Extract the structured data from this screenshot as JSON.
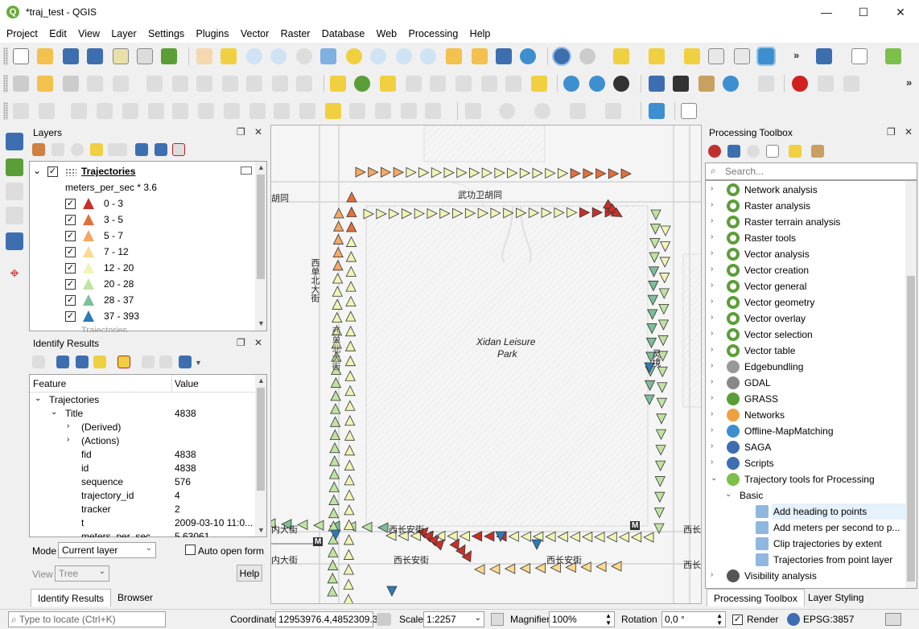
{
  "window": {
    "title": "*traj_test - QGIS",
    "minimize": "—",
    "maximize": "☐",
    "close": "✕"
  },
  "menu": [
    "Project",
    "Edit",
    "View",
    "Layer",
    "Settings",
    "Plugins",
    "Vector",
    "Raster",
    "Database",
    "Web",
    "Processing",
    "Help"
  ],
  "layers_panel": {
    "title": "Layers",
    "layer_name": "Trajectories",
    "classification_attr": "meters_per_sec * 3.6",
    "classes": [
      {
        "label": "0 - 3",
        "color": "#c8302a"
      },
      {
        "label": "3 - 5",
        "color": "#e36f3b"
      },
      {
        "label": "5 - 7",
        "color": "#f4a864"
      },
      {
        "label": "7 - 12",
        "color": "#fbd98e"
      },
      {
        "label": "12 - 20",
        "color": "#f0f5b6"
      },
      {
        "label": "20 - 28",
        "color": "#bfe3a2"
      },
      {
        "label": "28 - 37",
        "color": "#7cbf9a"
      },
      {
        "label": "37 - 393",
        "color": "#2c7bb6"
      }
    ],
    "second_layer": "Trajectories"
  },
  "identify_panel": {
    "title": "Identify Results",
    "col_feature": "Feature",
    "col_value": "Value",
    "rows": [
      {
        "feature": "Trajectories",
        "value": "",
        "indent": 0,
        "expand": "v"
      },
      {
        "feature": "Title",
        "value": "4838",
        "indent": 1,
        "expand": "v"
      },
      {
        "feature": "(Derived)",
        "value": "",
        "indent": 2,
        "expand": ">"
      },
      {
        "feature": "(Actions)",
        "value": "",
        "indent": 2,
        "expand": ">"
      },
      {
        "feature": "fid",
        "value": "4838",
        "indent": 3,
        "expand": ""
      },
      {
        "feature": "id",
        "value": "4838",
        "indent": 3,
        "expand": ""
      },
      {
        "feature": "sequence",
        "value": "576",
        "indent": 3,
        "expand": ""
      },
      {
        "feature": "trajectory_id",
        "value": "4",
        "indent": 3,
        "expand": ""
      },
      {
        "feature": "tracker",
        "value": "2",
        "indent": 3,
        "expand": ""
      },
      {
        "feature": "t",
        "value": "2009-03-10 11:0...",
        "indent": 3,
        "expand": ""
      },
      {
        "feature": "meters_per_sec",
        "value": "5.63061",
        "indent": 3,
        "expand": ""
      }
    ],
    "mode_label": "Mode",
    "mode_value": "Current layer",
    "auto_open_label": "Auto open form",
    "view_label": "View",
    "view_value": "Tree",
    "help_label": "Help",
    "tab_identify": "Identify Results",
    "tab_browser": "Browser"
  },
  "map": {
    "park_label_1": "Xidan Leisure",
    "park_label_2": "Park",
    "street_top": "武功卫胡同",
    "street_left": "西单北大街",
    "street_left2": "西单北大街",
    "street_bottom1": "西长安街",
    "street_bottom2": "西长安街",
    "street_bottom3": "西长安街",
    "street_bottom_right1": "西长安街",
    "street_bottom_right2": "西长安街",
    "street_corner": "胡同",
    "street_left_bottom1": "内大街",
    "street_left_bottom2": "内大街",
    "metro": "M",
    "street_right": "灵境"
  },
  "processing_toolbox": {
    "title": "Processing Toolbox",
    "search_placeholder": "Search...",
    "items": [
      {
        "label": "Network analysis",
        "icon": "qgis-icon",
        "expand": ">"
      },
      {
        "label": "Raster analysis",
        "icon": "qgis-icon",
        "expand": ">"
      },
      {
        "label": "Raster terrain analysis",
        "icon": "qgis-icon",
        "expand": ">"
      },
      {
        "label": "Raster tools",
        "icon": "qgis-icon",
        "expand": ">"
      },
      {
        "label": "Vector analysis",
        "icon": "qgis-icon",
        "expand": ">"
      },
      {
        "label": "Vector creation",
        "icon": "qgis-icon",
        "expand": ">"
      },
      {
        "label": "Vector general",
        "icon": "qgis-icon",
        "expand": ">"
      },
      {
        "label": "Vector geometry",
        "icon": "qgis-icon",
        "expand": ">"
      },
      {
        "label": "Vector overlay",
        "icon": "qgis-icon",
        "expand": ">"
      },
      {
        "label": "Vector selection",
        "icon": "qgis-icon",
        "expand": ">"
      },
      {
        "label": "Vector table",
        "icon": "qgis-icon",
        "expand": ">"
      },
      {
        "label": "Edgebundling",
        "icon": "edgebundling-icon",
        "expand": ">"
      },
      {
        "label": "GDAL",
        "icon": "gdal-icon",
        "expand": ">"
      },
      {
        "label": "GRASS",
        "icon": "grass-icon",
        "expand": ">"
      },
      {
        "label": "Networks",
        "icon": "networks-icon",
        "expand": ">"
      },
      {
        "label": "Offline-MapMatching",
        "icon": "mapmatching-icon",
        "expand": ">"
      },
      {
        "label": "SAGA",
        "icon": "saga-icon",
        "expand": ">"
      },
      {
        "label": "Scripts",
        "icon": "python-icon",
        "expand": ">"
      },
      {
        "label": "Trajectory tools for Processing",
        "icon": "trajectory-icon",
        "expand": "v"
      },
      {
        "label": "Basic",
        "icon": "",
        "expand": "v"
      },
      {
        "label": "Add heading to points",
        "icon": "tool-icon",
        "expand": ""
      },
      {
        "label": "Add meters per second to p...",
        "icon": "tool-icon",
        "expand": ""
      },
      {
        "label": "Clip trajectories by extent",
        "icon": "tool-icon",
        "expand": ""
      },
      {
        "label": "Trajectories from point layer",
        "icon": "tool-icon",
        "expand": ""
      },
      {
        "label": "Visibility analysis",
        "icon": "eye-icon",
        "expand": ">"
      }
    ],
    "tab_toolbox": "Processing Toolbox",
    "tab_styling": "Layer Styling"
  },
  "status": {
    "locate_placeholder": "Type to locate (Ctrl+K)",
    "coordinate_label": "Coordinate",
    "coordinate_value": "12953976.4,4852309.3",
    "scale_label": "Scale",
    "scale_value": "1:2257",
    "magnifier_label": "Magnifier",
    "magnifier_value": "100%",
    "rotation_label": "Rotation",
    "rotation_value": "0,0 °",
    "render_label": "Render",
    "crs": "EPSG:3857"
  }
}
